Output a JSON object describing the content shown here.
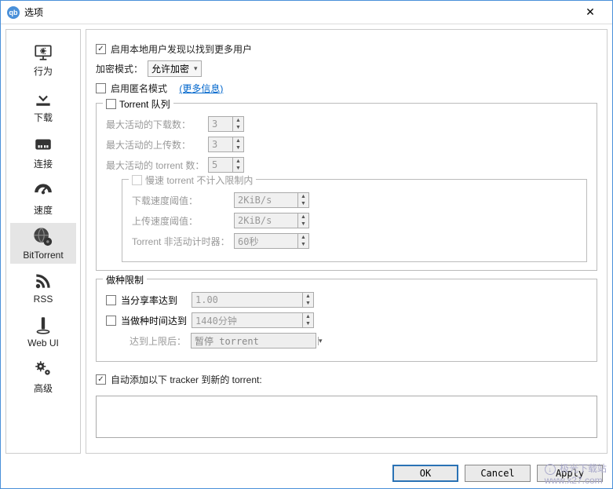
{
  "window": {
    "title": "选项",
    "app_icon_text": "qb"
  },
  "sidebar": {
    "items": [
      {
        "label": "行为"
      },
      {
        "label": "下载"
      },
      {
        "label": "连接"
      },
      {
        "label": "速度"
      },
      {
        "label": "BitTorrent"
      },
      {
        "label": "RSS"
      },
      {
        "label": "Web UI"
      },
      {
        "label": "高级"
      }
    ]
  },
  "privacy": {
    "lpd_label": "启用本地用户发现以找到更多用户",
    "encryption_label": "加密模式：",
    "encryption_value": "允许加密",
    "anon_label": "启用匿名模式",
    "more_info": "(更多信息)"
  },
  "queue": {
    "legend": "Torrent 队列",
    "max_dl_label": "最大活动的下载数：",
    "max_dl_value": "3",
    "max_ul_label": "最大活动的上传数：",
    "max_ul_value": "3",
    "max_active_label": "最大活动的 torrent 数：",
    "max_active_value": "5",
    "slow_legend": "慢速 torrent 不计入限制内",
    "dl_thresh_label": "下载速度阈值：",
    "dl_thresh_value": "2KiB/s",
    "ul_thresh_label": "上传速度阈值：",
    "ul_thresh_value": "2KiB/s",
    "inactive_label": "Torrent 非活动计时器：",
    "inactive_value": "60秒"
  },
  "seeding": {
    "legend": "做种限制",
    "ratio_label": "当分享率达到",
    "ratio_value": "1.00",
    "time_label": "当做种时间达到",
    "time_value": "1440分钟",
    "action_label": "达到上限后：",
    "action_value": "暂停 torrent"
  },
  "trackers": {
    "label": "自动添加以下 tracker 到新的 torrent:"
  },
  "buttons": {
    "ok": "OK",
    "cancel": "Cancel",
    "apply": "Apply"
  },
  "watermark": {
    "text": "极光下载站",
    "url": "www.x27.com"
  }
}
